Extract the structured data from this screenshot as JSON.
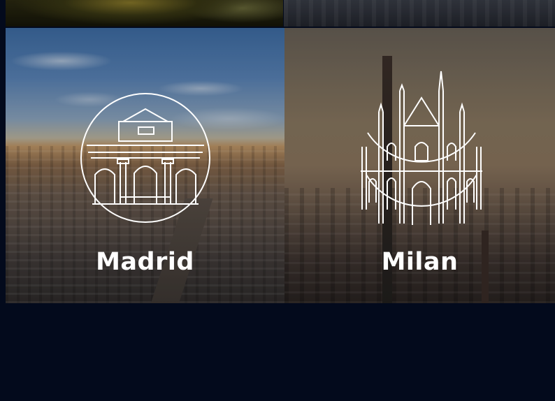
{
  "cities": {
    "madrid": {
      "name": "Madrid",
      "icon": "puerta-de-alcala-icon"
    },
    "milan": {
      "name": "Milan",
      "icon": "duomo-di-milano-icon"
    }
  },
  "colors": {
    "background": "#030a1c",
    "text": "#ffffff",
    "icon_stroke": "#ffffff"
  }
}
